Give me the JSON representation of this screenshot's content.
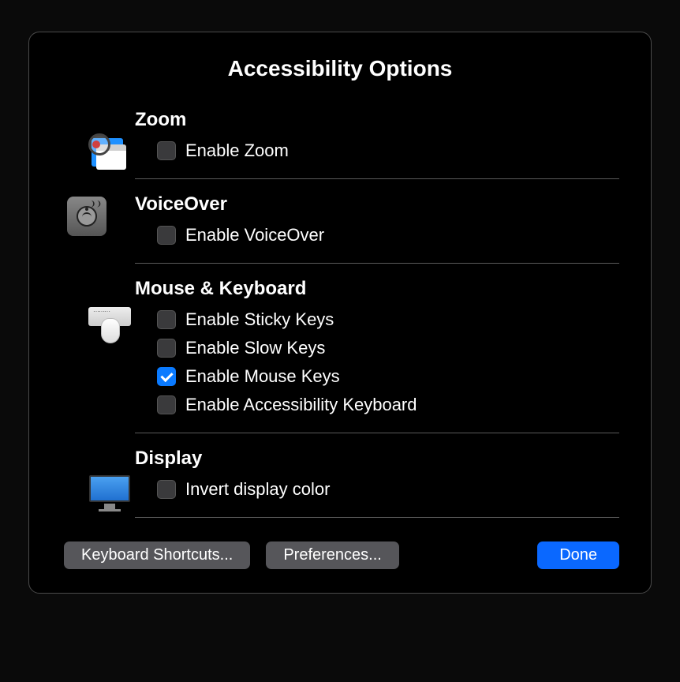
{
  "title": "Accessibility Options",
  "sections": {
    "zoom": {
      "title": "Zoom",
      "options": [
        {
          "label": "Enable Zoom",
          "checked": false
        }
      ]
    },
    "voiceover": {
      "title": "VoiceOver",
      "options": [
        {
          "label": "Enable VoiceOver",
          "checked": false
        }
      ]
    },
    "mouse_keyboard": {
      "title": "Mouse & Keyboard",
      "options": [
        {
          "label": "Enable Sticky Keys",
          "checked": false
        },
        {
          "label": "Enable Slow Keys",
          "checked": false
        },
        {
          "label": "Enable Mouse Keys",
          "checked": true
        },
        {
          "label": "Enable Accessibility Keyboard",
          "checked": false
        }
      ]
    },
    "display": {
      "title": "Display",
      "options": [
        {
          "label": "Invert display color",
          "checked": false
        }
      ]
    }
  },
  "buttons": {
    "shortcuts": "Keyboard Shortcuts...",
    "preferences": "Preferences...",
    "done": "Done"
  }
}
